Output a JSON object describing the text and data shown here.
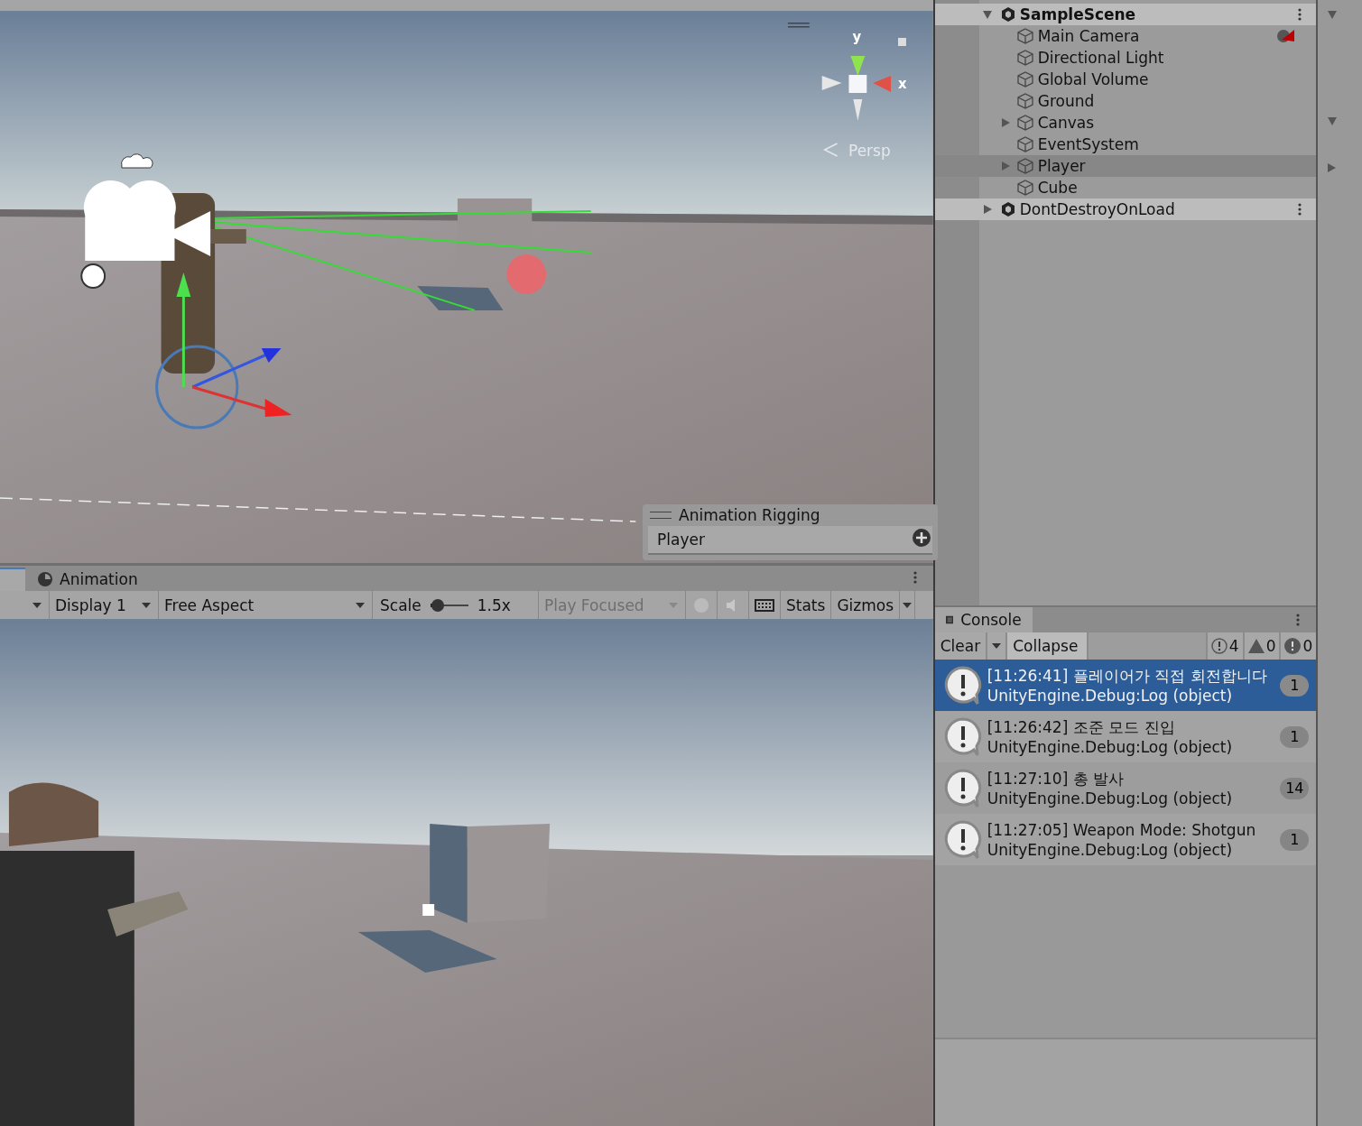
{
  "scene_view": {
    "axis_labels": [
      "y",
      "x"
    ],
    "projection": "Persp",
    "overlay": {
      "title": "Animation Rigging",
      "item": "Player"
    }
  },
  "dock_tab": {
    "label": "Animation"
  },
  "game_toolbar": {
    "display": "Display 1",
    "aspect": "Free Aspect",
    "scale_label": "Scale",
    "scale": {
      "level": 0.05,
      "reading": "1.5x"
    },
    "play_mode": "Play Focused",
    "stats": "Stats",
    "gizmos": "Gizmos"
  },
  "hierarchy": {
    "scenes": [
      {
        "name": "SampleScene",
        "expanded": true,
        "children": [
          {
            "name": "Main Camera",
            "has_children": false,
            "selected": false,
            "has_badge": true
          },
          {
            "name": "Directional Light",
            "has_children": false,
            "selected": false,
            "has_badge": false
          },
          {
            "name": "Global Volume",
            "has_children": false,
            "selected": false,
            "has_badge": false
          },
          {
            "name": "Ground",
            "has_children": false,
            "selected": false,
            "has_badge": false
          },
          {
            "name": "Canvas",
            "has_children": true,
            "selected": false,
            "has_badge": false
          },
          {
            "name": "EventSystem",
            "has_children": false,
            "selected": false,
            "has_badge": false
          },
          {
            "name": "Player",
            "has_children": true,
            "selected": true,
            "has_badge": false
          },
          {
            "name": "Cube",
            "has_children": false,
            "selected": false,
            "has_badge": false
          }
        ]
      },
      {
        "name": "DontDestroyOnLoad",
        "expanded": false
      }
    ]
  },
  "console": {
    "title": "Console",
    "clear": "Clear",
    "collapse": "Collapse",
    "counts": {
      "info": "4",
      "warning": "0",
      "error": "0"
    },
    "entries": [
      {
        "message": "[11:26:41] 플레이어가 직접 회전합니다",
        "source": "UnityEngine.Debug:Log (object)",
        "count": "1",
        "selected": true
      },
      {
        "message": "[11:26:42] 조준 모드 진입",
        "source": "UnityEngine.Debug:Log (object)",
        "count": "1",
        "selected": false
      },
      {
        "message": "[11:27:10] 총 발사",
        "source": "UnityEngine.Debug:Log (object)",
        "count": "14",
        "selected": false
      },
      {
        "message": "[11:27:05] Weapon Mode: Shotgun",
        "source": "UnityEngine.Debug:Log (object)",
        "count": "1",
        "selected": false
      }
    ]
  }
}
